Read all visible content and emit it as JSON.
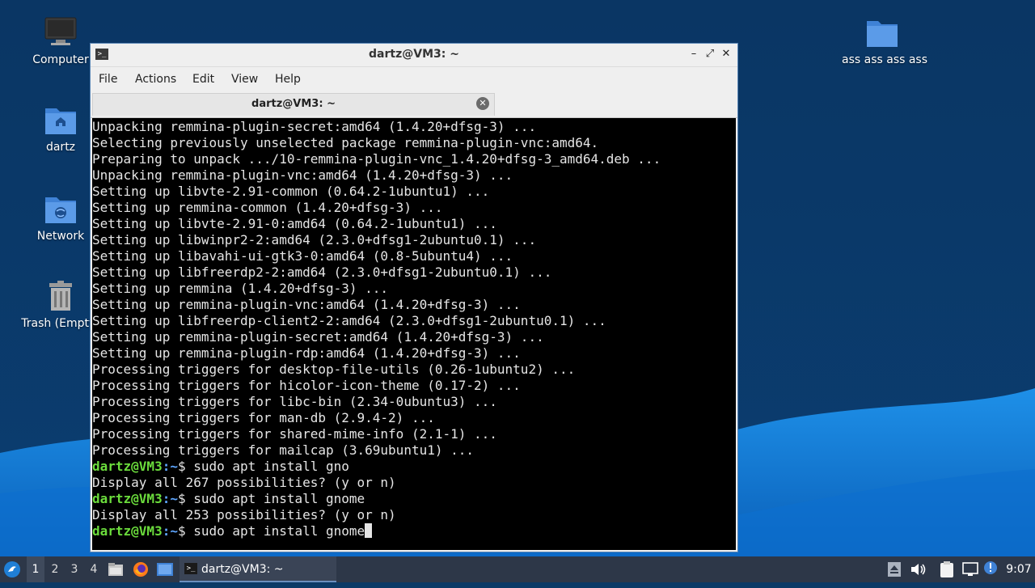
{
  "desktop": {
    "icons": [
      {
        "label": "Computer",
        "icon": "computer-icon"
      },
      {
        "label": "dartz",
        "icon": "home-folder-icon"
      },
      {
        "label": "Network",
        "icon": "network-folder-icon"
      },
      {
        "label": "Trash (Empty)",
        "icon": "trash-icon"
      },
      {
        "label": "ass ass ass ass",
        "icon": "folder-icon"
      }
    ]
  },
  "window": {
    "title": "dartz@VM3: ~",
    "controls": {
      "minimize": "–",
      "maximize": "⤢",
      "close": "✕"
    },
    "menu": [
      "File",
      "Actions",
      "Edit",
      "View",
      "Help"
    ],
    "tab": {
      "label": "dartz@VM3: ~",
      "close": "✕"
    }
  },
  "terminal": {
    "lines": [
      "Unpacking remmina-plugin-secret:amd64 (1.4.20+dfsg-3) ...",
      "Selecting previously unselected package remmina-plugin-vnc:amd64.",
      "Preparing to unpack .../10-remmina-plugin-vnc_1.4.20+dfsg-3_amd64.deb ...",
      "Unpacking remmina-plugin-vnc:amd64 (1.4.20+dfsg-3) ...",
      "Setting up libvte-2.91-common (0.64.2-1ubuntu1) ...",
      "Setting up remmina-common (1.4.20+dfsg-3) ...",
      "Setting up libvte-2.91-0:amd64 (0.64.2-1ubuntu1) ...",
      "Setting up libwinpr2-2:amd64 (2.3.0+dfsg1-2ubuntu0.1) ...",
      "Setting up libavahi-ui-gtk3-0:amd64 (0.8-5ubuntu4) ...",
      "Setting up libfreerdp2-2:amd64 (2.3.0+dfsg1-2ubuntu0.1) ...",
      "Setting up remmina (1.4.20+dfsg-3) ...",
      "Setting up remmina-plugin-vnc:amd64 (1.4.20+dfsg-3) ...",
      "Setting up libfreerdp-client2-2:amd64 (2.3.0+dfsg1-2ubuntu0.1) ...",
      "Setting up remmina-plugin-secret:amd64 (1.4.20+dfsg-3) ...",
      "Setting up remmina-plugin-rdp:amd64 (1.4.20+dfsg-3) ...",
      "Processing triggers for desktop-file-utils (0.26-1ubuntu2) ...",
      "Processing triggers for hicolor-icon-theme (0.17-2) ...",
      "Processing triggers for libc-bin (2.34-0ubuntu3) ...",
      "Processing triggers for man-db (2.9.4-2) ...",
      "Processing triggers for shared-mime-info (2.1-1) ...",
      "Processing triggers for mailcap (3.69ubuntu1) ..."
    ],
    "prompt_user": "dartz@VM3",
    "prompt_path": ":~",
    "prompt_symbol": "$ ",
    "session": [
      {
        "type": "cmd",
        "text": "sudo apt install gno"
      },
      {
        "type": "out",
        "text": "Display all 267 possibilities? (y or n)"
      },
      {
        "type": "cmd",
        "text": "sudo apt install gnome"
      },
      {
        "type": "out",
        "text": "Display all 253 possibilities? (y or n)"
      }
    ],
    "current_input": "sudo apt install gnome"
  },
  "taskbar": {
    "workspaces": [
      "1",
      "2",
      "3",
      "4"
    ],
    "active_workspace": "1",
    "task_label": "dartz@VM3: ~",
    "clock": "9:07"
  }
}
